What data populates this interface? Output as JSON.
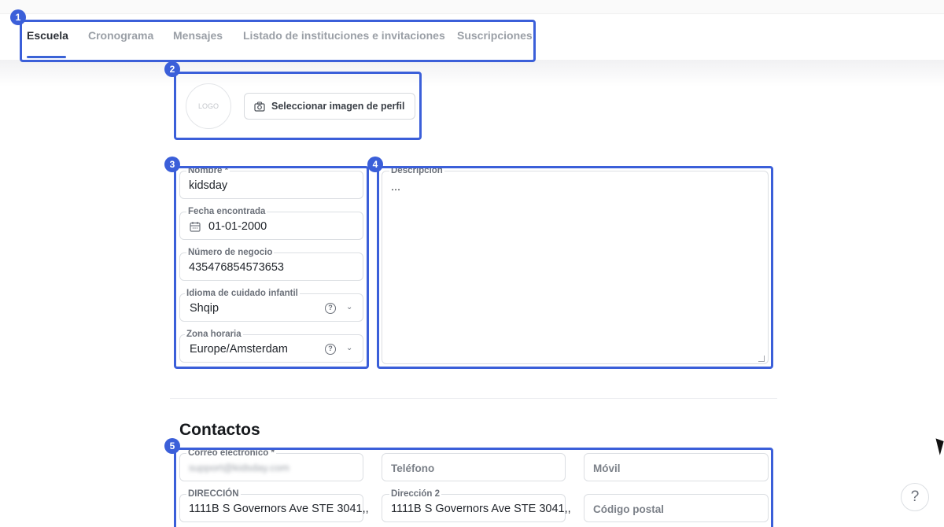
{
  "tabs": [
    {
      "label": "Escuela",
      "active": true
    },
    {
      "label": "Cronograma",
      "active": false
    },
    {
      "label": "Mensajes",
      "active": false
    },
    {
      "label": "Listado de instituciones e invitaciones",
      "active": false
    },
    {
      "label": "Suscripciones",
      "active": false
    }
  ],
  "callouts": [
    "1",
    "2",
    "3",
    "4",
    "5"
  ],
  "profile": {
    "logo_text": "LOGO",
    "upload_button": "Seleccionar imagen de perfil"
  },
  "form": {
    "nombre": {
      "label": "Nombre *",
      "value": "kidsday"
    },
    "fecha": {
      "label": "Fecha encontrada",
      "value": "01-01-2000"
    },
    "numero": {
      "label": "Número de negocio",
      "value": "435476854573653"
    },
    "idioma": {
      "label": "Idioma de cuidado infantil",
      "value": "Shqip"
    },
    "zona": {
      "label": "Zona horaria",
      "value": "Europe/Amsterdam"
    },
    "descripcion": {
      "label": "Descripción",
      "value": "..."
    }
  },
  "contacts": {
    "title": "Contactos",
    "correo": {
      "label": "Correo electrónico *",
      "value": "support@kidsday.com"
    },
    "telefono": {
      "placeholder": "Teléfono"
    },
    "movil": {
      "placeholder": "Móvil"
    },
    "direccion": {
      "label": "DIRECCIÓN",
      "value": "1111B S Governors Ave STE 3041,,"
    },
    "direccion2": {
      "label": "Dirección 2",
      "value": "1111B S Governors Ave STE 3041,,"
    },
    "postal": {
      "placeholder": "Código postal"
    }
  },
  "help_button": "?",
  "colors": {
    "accent": "#3b5fd9",
    "tab_underline": "#3b63d6"
  },
  "icons": [
    "camera-icon",
    "calendar-icon",
    "help-circle-icon",
    "chevron-down-icon",
    "question-icon"
  ]
}
